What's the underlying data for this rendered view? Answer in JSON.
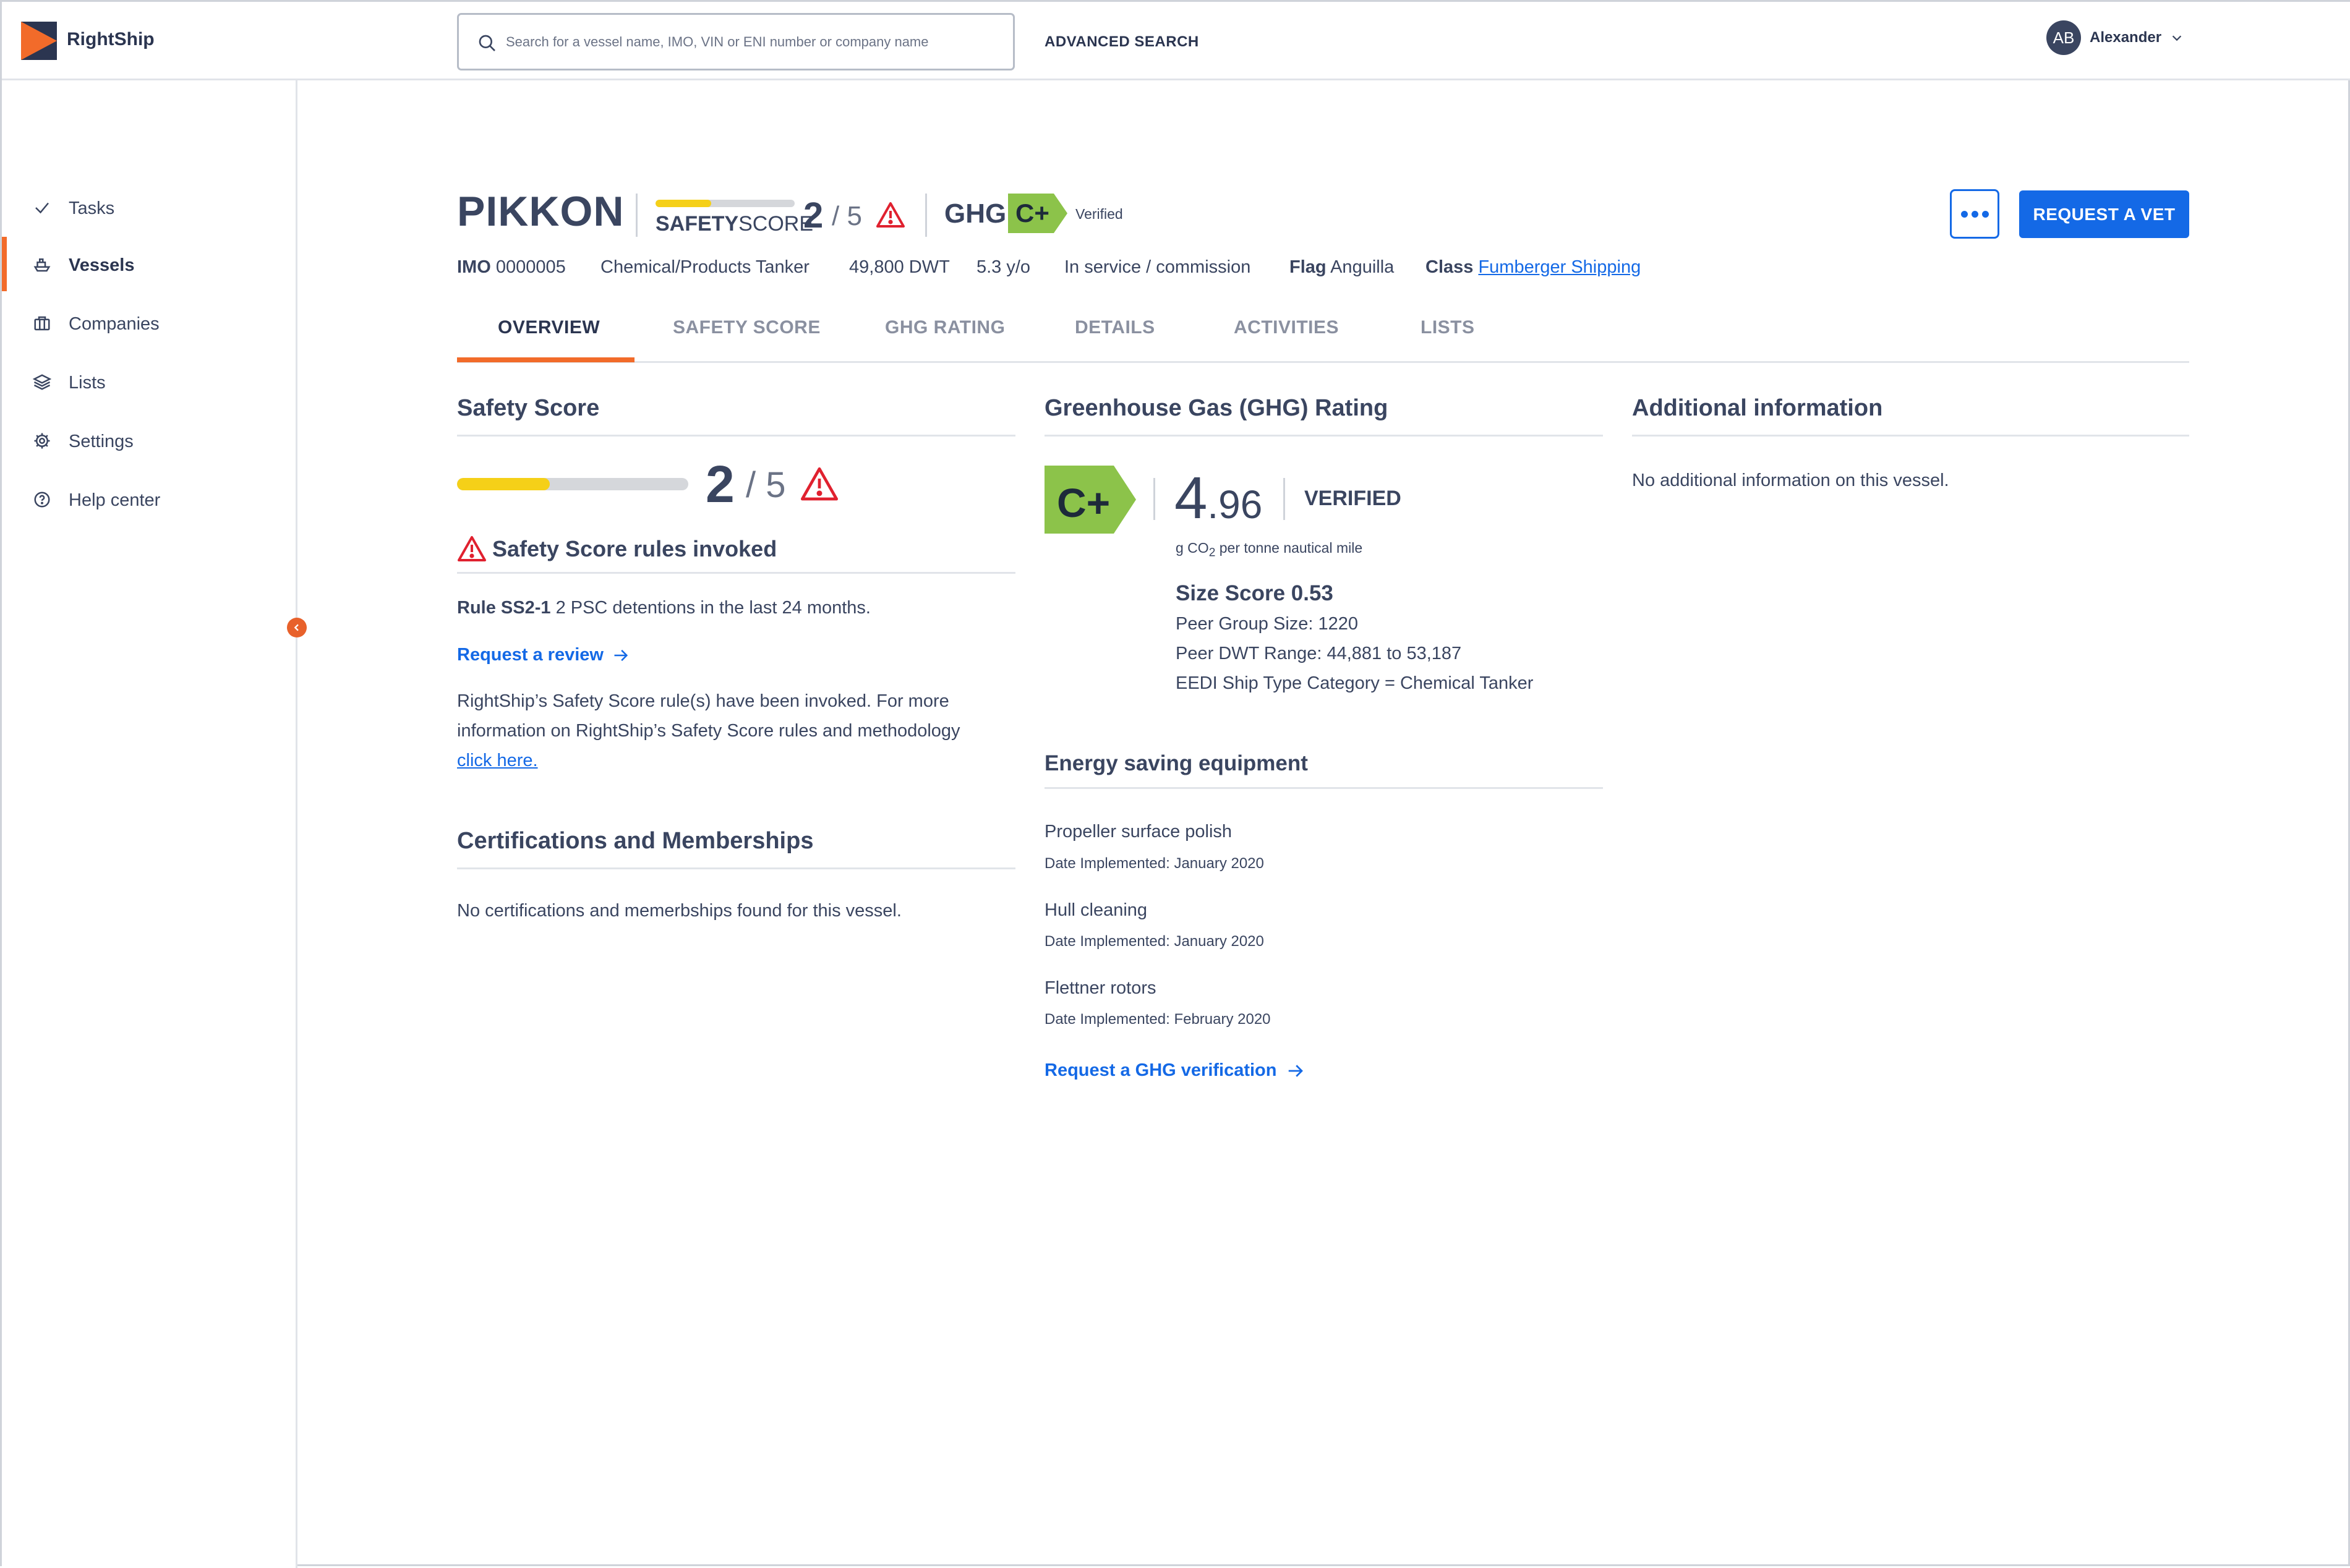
{
  "app": {
    "brand": "RightShip",
    "brand_color": "#f26b2a",
    "accent_color": "#1469e6"
  },
  "header": {
    "search_placeholder": "Search for a vessel name, IMO, VIN or ENI number or company name",
    "advanced_search": "ADVANCED SEARCH",
    "user": {
      "initials": "AB",
      "name": "Alexander"
    }
  },
  "sidebar": {
    "items": [
      {
        "label": "Tasks",
        "icon": "check-icon"
      },
      {
        "label": "Vessels",
        "icon": "ship-icon",
        "active": true
      },
      {
        "label": "Companies",
        "icon": "briefcase-icon"
      },
      {
        "label": "Lists",
        "icon": "layers-icon"
      },
      {
        "label": "Settings",
        "icon": "gear-icon"
      },
      {
        "label": "Help center",
        "icon": "help-circle-icon"
      }
    ]
  },
  "vessel": {
    "name": "PIKKON",
    "safety_label_bold": "SAFETY",
    "safety_label": "SCORE",
    "safety_score": "2",
    "safety_max": "/ 5",
    "safety_fraction": 0.4,
    "ghg_label": "GHG",
    "ghg_rating": "C+",
    "ghg_status": "Verified",
    "ghg_color": "#8cc34a",
    "more_label": "more-options",
    "request_vet": "REQUEST A VET",
    "meta": {
      "imo_label": "IMO",
      "imo": "0000005",
      "type": "Chemical/Products Tanker",
      "dwt": "49,800 DWT",
      "age": "5.3 y/o",
      "status": "In service / commission",
      "flag_label": "Flag",
      "flag": "Anguilla",
      "class_label": "Class",
      "class": "Fumberger Shipping"
    }
  },
  "tabs": [
    "OVERVIEW",
    "SAFETY SCORE",
    "GHG RATING",
    "DETAILS",
    "ACTIVITIES",
    "LISTS"
  ],
  "safety": {
    "title": "Safety Score",
    "score": "2",
    "max": "/ 5",
    "rules_title": "Safety Score rules invoked",
    "rule_label": "Rule SS2-1",
    "rule_text": "2 PSC detentions in the last 24 months.",
    "review_link": "Request a review",
    "info_line1": "RightShip’s Safety Score rule(s) have been invoked. For more",
    "info_line2": "information on RightShip’s Safety Score rules and methodology",
    "info_link": "click here."
  },
  "certs": {
    "title": "Certifications and Memberships",
    "empty": "No certifications and memerbships found for this vessel."
  },
  "ghg": {
    "title": "Greenhouse Gas (GHG) Rating",
    "rating": "C+",
    "value_int": "4",
    "value_dec": ".96",
    "verified": "VERIFIED",
    "unit_prefix": "g CO",
    "unit_sub": "2",
    "unit_suffix": " per tonne nautical mile",
    "size_score": "Size Score 0.53",
    "peer_group": "Peer Group Size: 1220",
    "peer_dwt": "Peer DWT Range: 44,881 to 53,187",
    "eedi": "EEDI Ship Type Category = Chemical Tanker"
  },
  "energy": {
    "title": "Energy saving equipment",
    "items": [
      {
        "name": "Propeller surface polish",
        "date": "Date Implemented: January 2020"
      },
      {
        "name": "Hull cleaning",
        "date": "Date Implemented: January 2020"
      },
      {
        "name": "Flettner rotors",
        "date": "Date Implemented: February 2020"
      }
    ],
    "verify_link": "Request a GHG verification"
  },
  "additional": {
    "title": "Additional information",
    "empty": "No additional information on this vessel."
  }
}
